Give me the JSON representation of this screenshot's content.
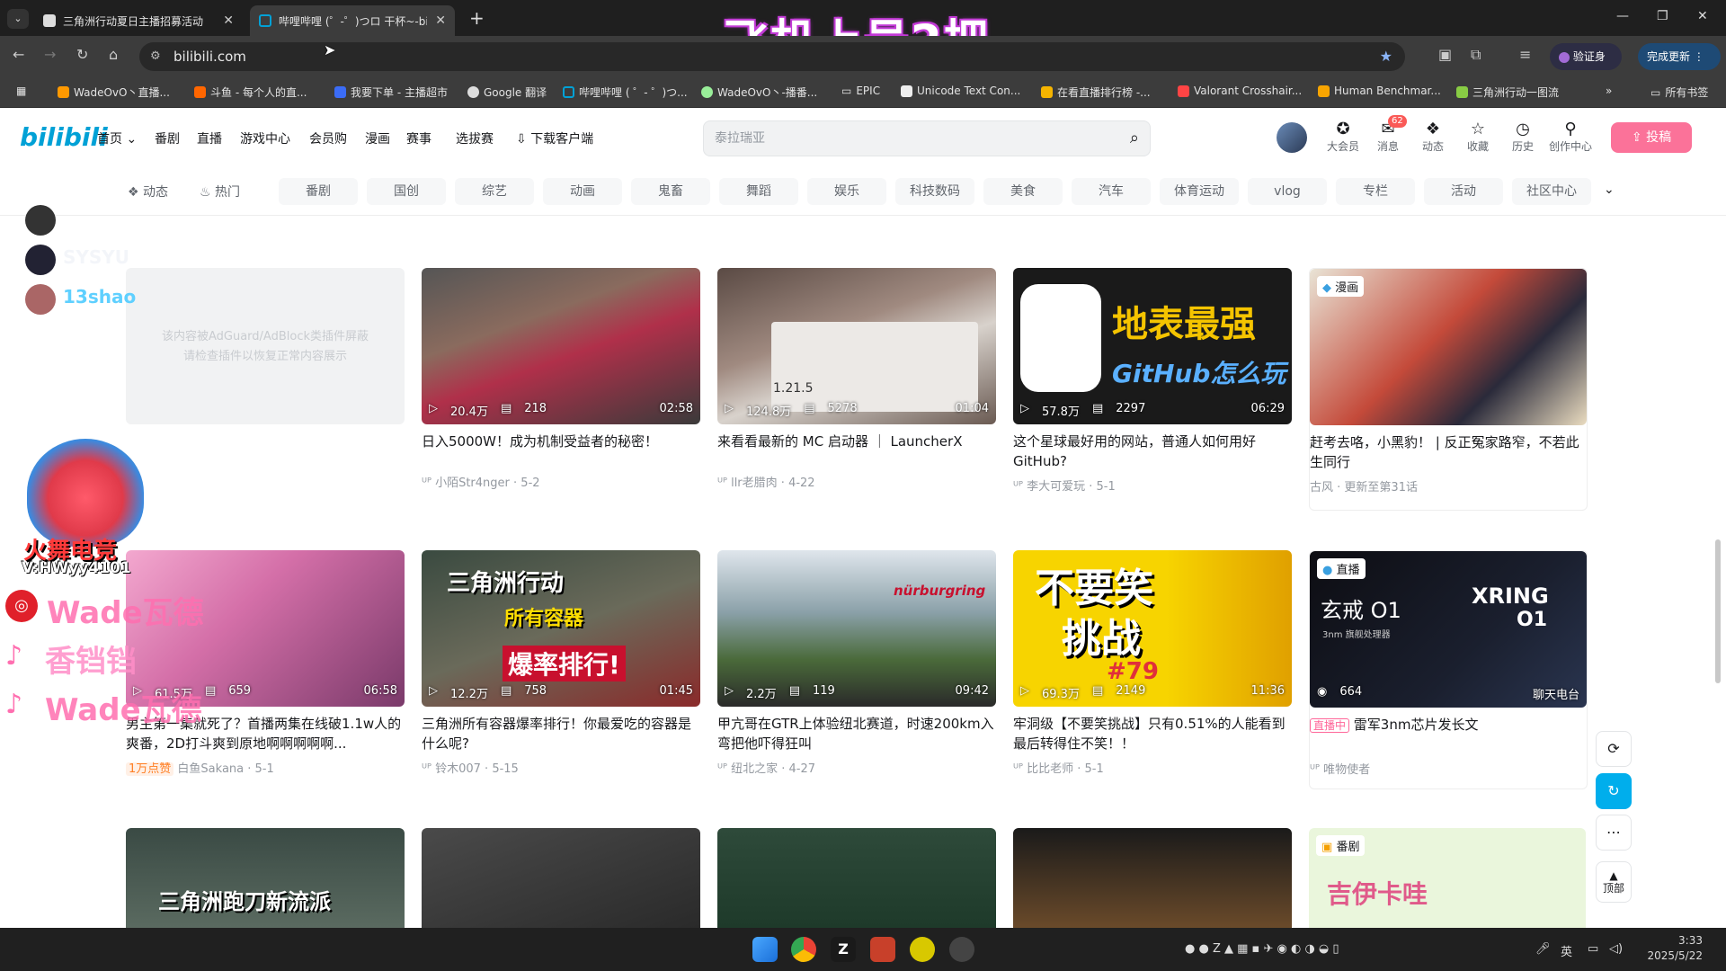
{
  "browser": {
    "tabs": [
      {
        "title": "三角洲行动夏日主播招募活动",
        "active": false
      },
      {
        "title": "哔哩哔哩 (゜-゜)つロ 干杯~-bi",
        "active": true
      }
    ],
    "new_tab": "+",
    "overlay_title": "飞机上号2把",
    "url": "bilibili.com",
    "verify_label": "验证身份",
    "update_label": "完成更新",
    "bookmarks": [
      "WadeOvO丶直播...",
      "斗鱼 - 每个人的直...",
      "我要下单 - 主播超市",
      "Google 翻译",
      "哔哩哔哩 ( ゜- ゜)つ...",
      "WadeOvO丶-播番...",
      "EPIC",
      "Unicode Text Con...",
      "在看直播排行榜 -...",
      "Valorant Crosshair...",
      "Human Benchmar...",
      "三角洲行动一图流"
    ],
    "all_bookmarks": "所有书签"
  },
  "bili": {
    "logo": "bilibili",
    "nav": [
      "首页",
      "番剧",
      "直播",
      "游戏中心",
      "会员购",
      "漫画",
      "赛事",
      "选拔赛",
      "下载客户端"
    ],
    "search_placeholder": "泰拉瑞亚",
    "header_icons": [
      {
        "label": "大会员",
        "icon": "vip-icon"
      },
      {
        "label": "消息",
        "icon": "message-icon",
        "badge": "62"
      },
      {
        "label": "动态",
        "icon": "dynamic-icon"
      },
      {
        "label": "收藏",
        "icon": "star-icon"
      },
      {
        "label": "历史",
        "icon": "history-icon"
      },
      {
        "label": "创作中心",
        "icon": "lightbulb-icon"
      }
    ],
    "upload_label": "投稿",
    "channel_links": [
      "动态",
      "热门"
    ],
    "channels": [
      "番剧",
      "国创",
      "综艺",
      "动画",
      "鬼畜",
      "舞蹈",
      "娱乐",
      "科技数码",
      "美食",
      "汽车",
      "体育运动",
      "vlog",
      "专栏",
      "活动",
      "社区中心"
    ],
    "adblock_notice": [
      "该内容被AdGuard/AdBlock类插件屏蔽",
      "请检查插件以恢复正常内容展示"
    ],
    "cards_row1": [
      {
        "views": "20.4万",
        "danmaku": "218",
        "duration": "02:58",
        "title": "日入5000W！成为机制受益者的秘密！",
        "author": "小陌Str4nger",
        "date": "5-2",
        "tag": ""
      },
      {
        "views": "124.8万",
        "danmaku": "5278",
        "duration": "01:04",
        "title": "来看看最新的 MC 启动器 ｜ LauncherX",
        "author": "llr老腊肉",
        "date": "4-22",
        "tag": ""
      },
      {
        "views": "57.8万",
        "danmaku": "2297",
        "duration": "06:29",
        "title": "这个星球最好用的网站，普通人如何用好GitHub?",
        "author": "李大可爱玩",
        "date": "5-1",
        "tag": ""
      },
      {
        "views": "",
        "danmaku": "",
        "duration": "",
        "title": "赶考去咯，小黑豹！ | 反正冤家路窄，不若此生同行",
        "author": "古风",
        "date": "更新至第31话",
        "tag": "漫画"
      }
    ],
    "cards_row2": [
      {
        "views": "61.5万",
        "danmaku": "659",
        "duration": "06:58",
        "title": "男主第一集就死了？首播两集在线破1.1w人的爽番，2D打斗爽到原地啊啊啊啊啊...",
        "author": "白鱼Sakana",
        "date": "5-1",
        "tag": "",
        "badge": "1万点赞"
      },
      {
        "views": "12.2万",
        "danmaku": "758",
        "duration": "01:45",
        "title": "三角洲所有容器爆率排行！你最爱吃的容器是什么呢?",
        "author": "铃木007",
        "date": "5-15",
        "tag": ""
      },
      {
        "views": "2.2万",
        "danmaku": "119",
        "duration": "09:42",
        "title": "甲亢哥在GTR上体验纽北赛道，时速200km入弯把他吓得狂叫",
        "author": "纽北之家",
        "date": "4-27",
        "tag": ""
      },
      {
        "views": "69.3万",
        "danmaku": "2149",
        "duration": "11:36",
        "title": "牢洞级【不要笑挑战】只有0.51%的人能看到最后转得住不笑！！",
        "author": "比比老师",
        "date": "5-1",
        "tag": ""
      },
      {
        "views": "664",
        "danmaku": "",
        "duration": "聊天电台",
        "title": "雷军3nm芯片发长文",
        "author": "唯物使者",
        "date": "",
        "tag": "直播",
        "live": "直播中"
      }
    ],
    "cards_row3_tags": [
      "",
      "",
      "",
      "",
      "番剧"
    ],
    "thumb_texts": {
      "github": [
        "地表最强",
        "GitHub怎么玩"
      ],
      "laugh": [
        "不要笑",
        "挑战",
        "#79"
      ],
      "delta": [
        "三角洲行动",
        "所有容器",
        "爆率排行!"
      ],
      "chip": [
        "XRING",
        "O1",
        "玄戒 O1",
        "3nm 旗舰处理器"
      ],
      "mc": "1.21.5",
      "nurburgring": "nürburgring",
      "row3": [
        "三角洲跑刀新流派",
        "吉伊卡哇"
      ]
    },
    "side_buttons": [
      "顶部"
    ]
  },
  "stream_overlay": {
    "viewers": [
      "SYSYU",
      "13shao"
    ],
    "mascot_text": [
      "火舞电竞",
      "V:HWyy4101"
    ],
    "social": [
      "Wade瓦德",
      "香铛铛",
      "Wade瓦德"
    ]
  },
  "taskbar": {
    "time": "3:33",
    "date": "2025/5/22",
    "ime": "英"
  }
}
